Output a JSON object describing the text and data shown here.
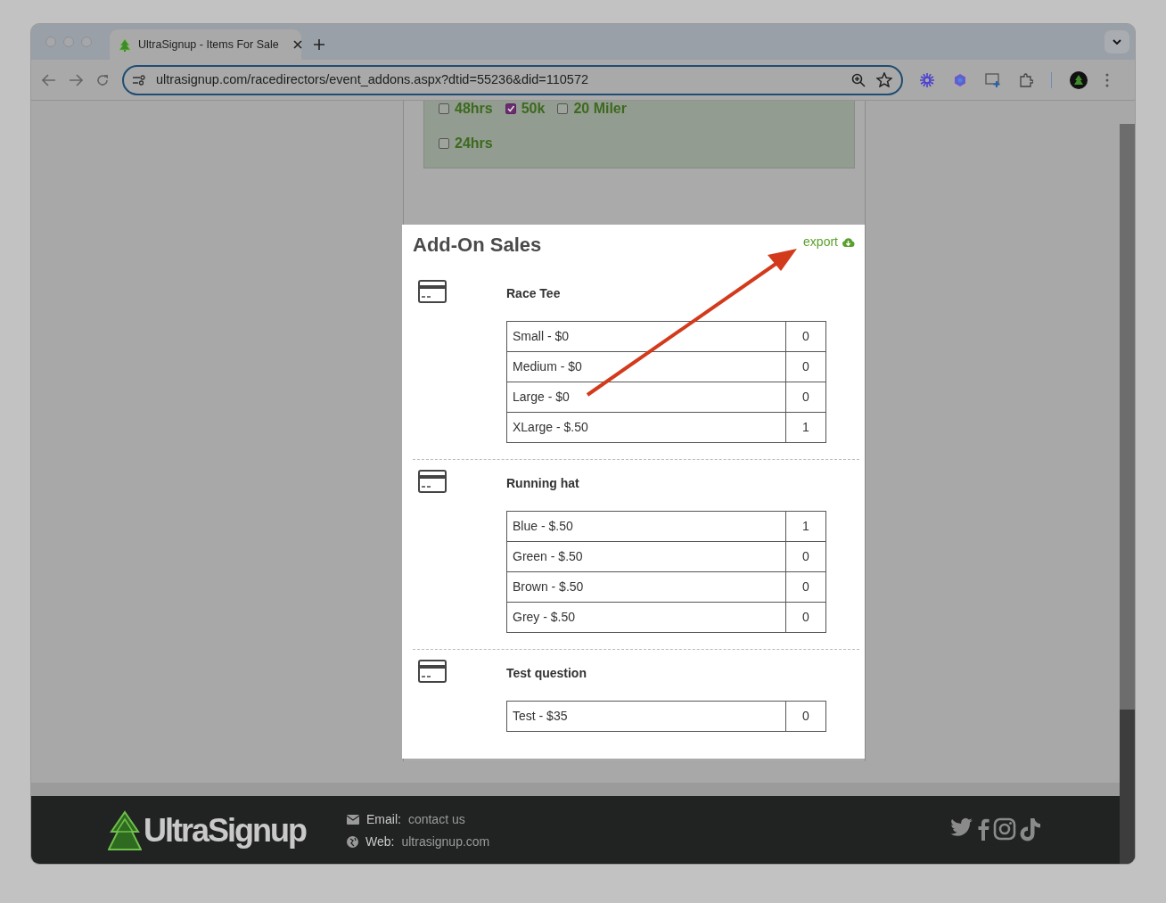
{
  "browser": {
    "tab_title": "UltraSignup - Items For Sale",
    "url": "ultrasignup.com/racedirectors/event_addons.aspx?dtid=55236&did=110572"
  },
  "distance_filter_rows": [
    {
      "items": [
        {
          "label": "48hrs",
          "checked": false
        },
        {
          "label": "50k",
          "checked": true
        },
        {
          "label": "20 Miler",
          "checked": false
        }
      ]
    },
    {
      "items": [
        {
          "label": "24hrs",
          "checked": false
        }
      ]
    }
  ],
  "addon_sales": {
    "title": "Add-On Sales",
    "export_label": "export",
    "items": [
      {
        "name": "Race Tee",
        "options": [
          {
            "label": "Small - $0",
            "count": "0"
          },
          {
            "label": "Medium - $0",
            "count": "0"
          },
          {
            "label": "Large - $0",
            "count": "0"
          },
          {
            "label": "XLarge - $.50",
            "count": "1"
          }
        ]
      },
      {
        "name": "Running hat",
        "options": [
          {
            "label": "Blue - $.50",
            "count": "1"
          },
          {
            "label": "Green - $.50",
            "count": "0"
          },
          {
            "label": "Brown - $.50",
            "count": "0"
          },
          {
            "label": "Grey - $.50",
            "count": "0"
          }
        ]
      },
      {
        "name": "Test question",
        "options": [
          {
            "label": "Test - $35",
            "count": "0"
          }
        ]
      }
    ]
  },
  "footer": {
    "logo": "UltraSignup",
    "email_label": "Email:",
    "email_link": "contact us",
    "web_label": "Web:",
    "web_link": "ultrasignup.com"
  }
}
